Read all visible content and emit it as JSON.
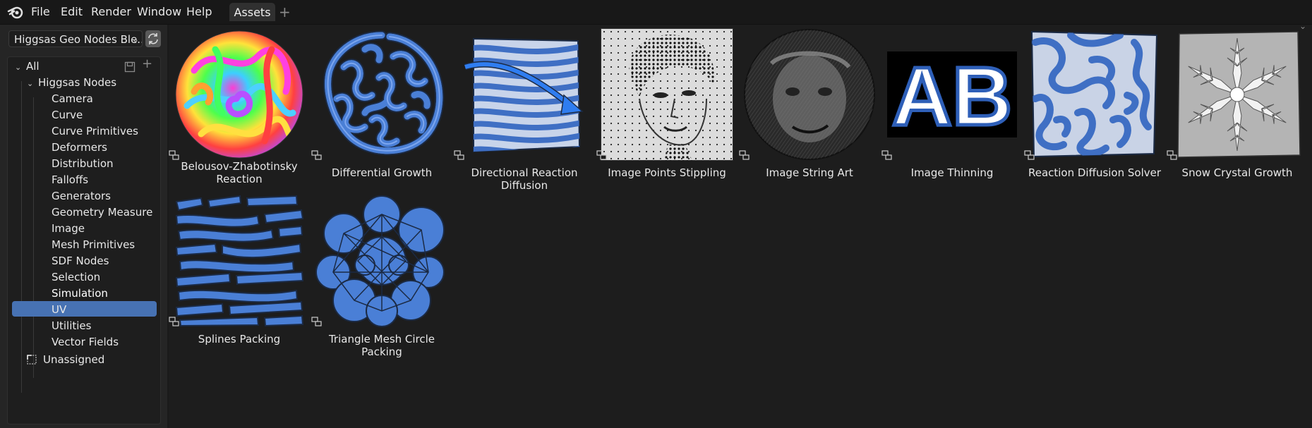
{
  "menu": {
    "items": [
      "File",
      "Edit",
      "Render",
      "Window",
      "Help"
    ]
  },
  "workspace": {
    "tab": "Assets",
    "add": "+"
  },
  "library": {
    "name": "Higgsas Geo Nodes Ble..."
  },
  "tree": {
    "all": "All",
    "group": "Higgsas Nodes",
    "children": [
      "Camera",
      "Curve",
      "Curve Primitives",
      "Deformers",
      "Distribution",
      "Falloffs",
      "Generators",
      "Geometry Measure",
      "Image",
      "Mesh Primitives",
      "SDF Nodes",
      "Selection",
      "Simulation",
      "UV",
      "Utilities",
      "Vector Fields"
    ],
    "selected": "Simulation",
    "unassigned": "Unassigned"
  },
  "assets": [
    {
      "name": "Belousov-Zhabotinsky\nReaction",
      "icon": "node-group-icon"
    },
    {
      "name": "Differential Growth",
      "icon": "node-group-icon"
    },
    {
      "name": "Directional Reaction Diffusion",
      "icon": "node-group-icon"
    },
    {
      "name": "Image Points Stippling",
      "icon": "node-group-icon"
    },
    {
      "name": "Image String Art",
      "icon": "node-group-icon"
    },
    {
      "name": "Image Thinning",
      "icon": "node-group-icon"
    },
    {
      "name": "Reaction Diffusion Solver",
      "icon": "node-group-icon"
    },
    {
      "name": "Snow Crystal Growth",
      "icon": "node-group-icon"
    },
    {
      "name": "Splines Packing",
      "icon": "node-group-icon"
    },
    {
      "name": "Triangle Mesh Circle Packing",
      "icon": "node-group-icon"
    }
  ],
  "thumb_text": {
    "ab": "AB"
  },
  "colors": {
    "accent": "#4772b3",
    "pattern_blue": "#4a7fd6",
    "bg": "#1d1d1d"
  }
}
